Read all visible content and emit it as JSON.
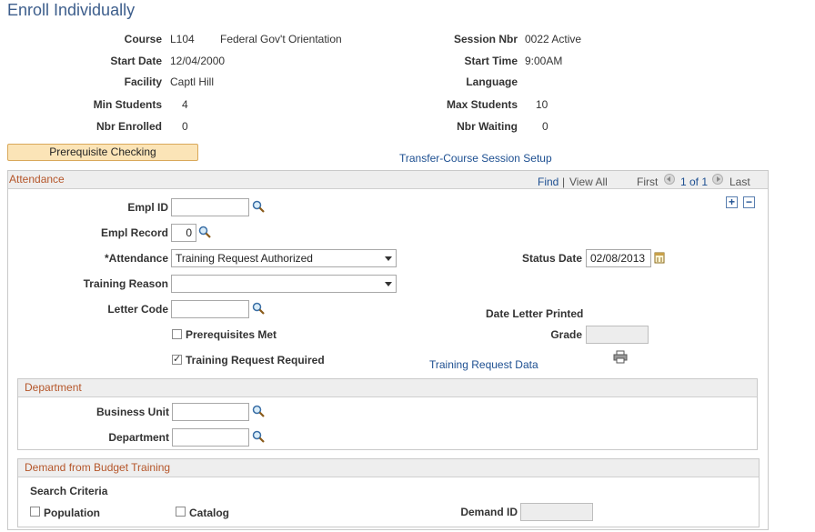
{
  "page": {
    "title": "Enroll Individually"
  },
  "course_info": {
    "course_label": "Course",
    "course_code": "L104",
    "course_name": "Federal Gov't Orientation",
    "session_nbr_label": "Session Nbr",
    "session_nbr_value": "0022 Active",
    "start_date_label": "Start Date",
    "start_date_value": "12/04/2000",
    "start_time_label": "Start Time",
    "start_time_value": "9:00AM",
    "facility_label": "Facility",
    "facility_value": "Captl Hill",
    "language_label": "Language",
    "min_students_label": "Min Students",
    "min_students_value": "4",
    "max_students_label": "Max Students",
    "max_students_value": "10",
    "nbr_enrolled_label": "Nbr Enrolled",
    "nbr_enrolled_value": "0",
    "nbr_waiting_label": "Nbr Waiting",
    "nbr_waiting_value": "0"
  },
  "actions": {
    "prereq_button": "Prerequisite Checking",
    "transfer_link": "Transfer-Course Session Setup"
  },
  "attendance": {
    "section_title": "Attendance",
    "find": "Find",
    "separator": "|",
    "view_all": "View All",
    "first": "First",
    "pager": "1 of 1",
    "last": "Last",
    "add_row": "+",
    "delete_row": "−",
    "empl_id_label": "Empl ID",
    "empl_id_value": "",
    "empl_record_label": "Empl Record",
    "empl_record_value": "0",
    "attendance_label": "*Attendance",
    "attendance_value": "Training Request Authorized",
    "status_date_label": "Status Date",
    "status_date_value": "02/08/2013",
    "training_reason_label": "Training Reason",
    "training_reason_value": "",
    "letter_code_label": "Letter Code",
    "letter_code_value": "",
    "date_letter_printed_label": "Date Letter Printed",
    "prereq_met_label": "Prerequisites Met",
    "prereq_met_checked": false,
    "grade_label": "Grade",
    "grade_value": "",
    "training_request_required_label": "Training Request Required",
    "training_request_required_checked": true,
    "training_request_data_link": "Training Request Data"
  },
  "department": {
    "section_title": "Department",
    "business_unit_label": "Business Unit",
    "business_unit_value": "",
    "department_label": "Department",
    "department_value": ""
  },
  "demand": {
    "section_title": "Demand from Budget Training",
    "search_criteria_label": "Search Criteria",
    "population_label": "Population",
    "population_checked": false,
    "catalog_label": "Catalog",
    "catalog_checked": false,
    "demand_id_label": "Demand ID",
    "demand_id_value": ""
  },
  "colors": {
    "title": "#3d5e8c",
    "link": "#1d4f91",
    "section_title": "#b5562a",
    "button_bg": "#fbe4b7"
  }
}
